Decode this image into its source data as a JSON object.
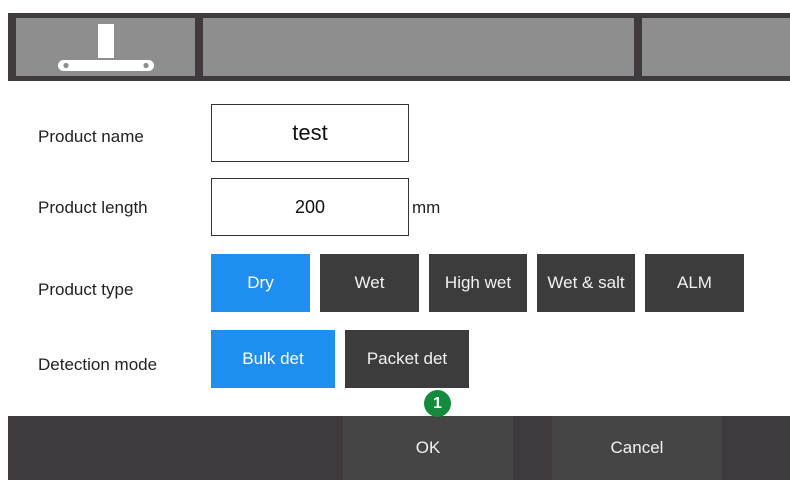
{
  "form": {
    "product_name_label": "Product name",
    "product_name_value": "test",
    "product_length_label": "Product length",
    "product_length_value": "200",
    "product_length_unit": "mm",
    "product_type_label": "Product type",
    "detection_mode_label": "Detection mode"
  },
  "product_types": [
    {
      "label": "Dry",
      "selected": true
    },
    {
      "label": "Wet",
      "selected": false
    },
    {
      "label": "High wet",
      "selected": false
    },
    {
      "label": "Wet & salt",
      "selected": false
    },
    {
      "label": "ALM",
      "selected": false
    }
  ],
  "detection_modes": [
    {
      "label": "Bulk det",
      "selected": true
    },
    {
      "label": "Packet det",
      "selected": false
    }
  ],
  "footer": {
    "ok_label": "OK",
    "cancel_label": "Cancel"
  },
  "annotation": {
    "badge": "1"
  },
  "icons": {
    "header_icon": "conveyor-detector-icon"
  },
  "colors": {
    "selected": "#1e8ff0",
    "unselected": "#3c3c3c",
    "badge": "#148a3c",
    "bar": "#3f3a3e"
  }
}
